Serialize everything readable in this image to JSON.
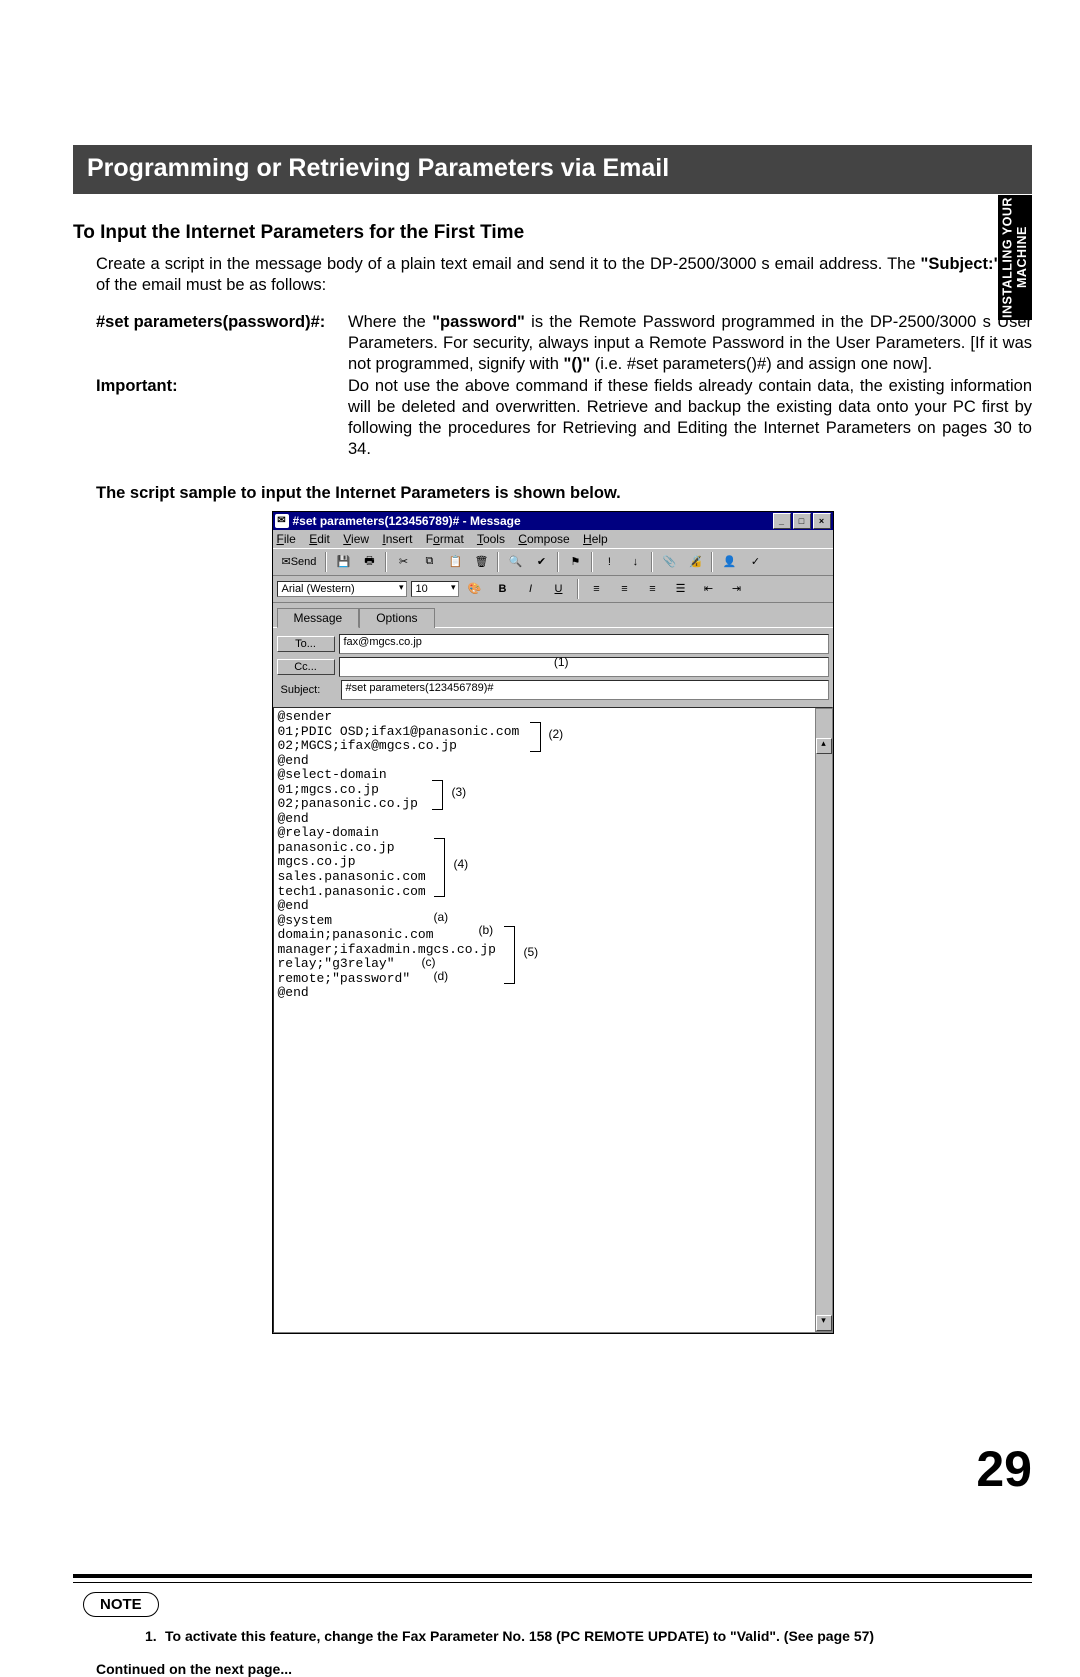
{
  "side_tab": "INSTALLING\nYOUR MACHINE",
  "title_bar": "Programming or Retrieving Parameters via Email",
  "section_head": "To Input the Internet Parameters for the First Time",
  "intro_part1": "Create a script in the message body of a plain text email and send it to the DP-2500/3000 s email address. The ",
  "intro_bold": "\"Subject:\"",
  "intro_part2": " line of the email must be as follows:",
  "dl1_term": "#set parameters(password)#",
  "dl1_def_a": "Where the ",
  "dl1_def_pw": "\"password\"",
  "dl1_def_b": " is the Remote Password programmed in the DP-2500/3000 s  User Parameters.   For security, always input a Remote Password in the User Parameters.    [If it was not programmed, signify with ",
  "dl1_def_paren": "\"()\"",
  "dl1_def_c": " (i.e. #set parameters()#) and assign one now].",
  "dl2_term": "Important",
  "dl2_def": "Do not use the above command if these fields already contain data, the existing information will be deleted and overwritten.  Retrieve and backup the existing data onto your PC first by following the procedures for Retrieving and Editing the Internet Parameters on pages 30 to 34.",
  "sample_caption": "The script sample to input the Internet Parameters is shown below.",
  "win": {
    "title": "#set parameters(123456789)# - Message",
    "menus": [
      "File",
      "Edit",
      "View",
      "Insert",
      "Format",
      "Tools",
      "Compose",
      "Help"
    ],
    "send": "Send",
    "font": "Arial (Western)",
    "size": "10",
    "tab1": "Message",
    "tab2": "Options",
    "to_lbl": "To...",
    "to_val": "fax@mgcs.co.jp",
    "cc_lbl": "Cc...",
    "subj_lbl": "Subject:",
    "subj_val": "#set parameters(123456789)#",
    "body": "@sender\n01;PDIC OSD;ifax1@panasonic.com\n02;MGCS;ifax@mgcs.co.jp\n@end\n@select-domain\n01;mgcs.co.jp\n02;panasonic.co.jp\n@end\n@relay-domain\npanasonic.co.jp\nmgcs.co.jp\nsales.panasonic.com\ntech1.panasonic.com\n@end\n@system\ndomain;panasonic.com\nmanager;ifaxadmin.mgcs.co.jp\nrelay;\"g3relay\"\nremote;\"password\"\n@end",
    "ann1": "(1)",
    "ann2": "(2)",
    "ann3": "(3)",
    "ann4": "(4)",
    "ann5": "(5)",
    "anna": "(a)",
    "annb": "(b)",
    "annc": "(c)",
    "annd": "(d)"
  },
  "note_label": "NOTE",
  "note_item_num": "1.",
  "note_item": "To activate this feature, change the Fax Parameter No. 158 (PC REMOTE UPDATE) to \"Valid\". (See page 57)",
  "continued": "Continued on the next page...",
  "page_num": "29"
}
